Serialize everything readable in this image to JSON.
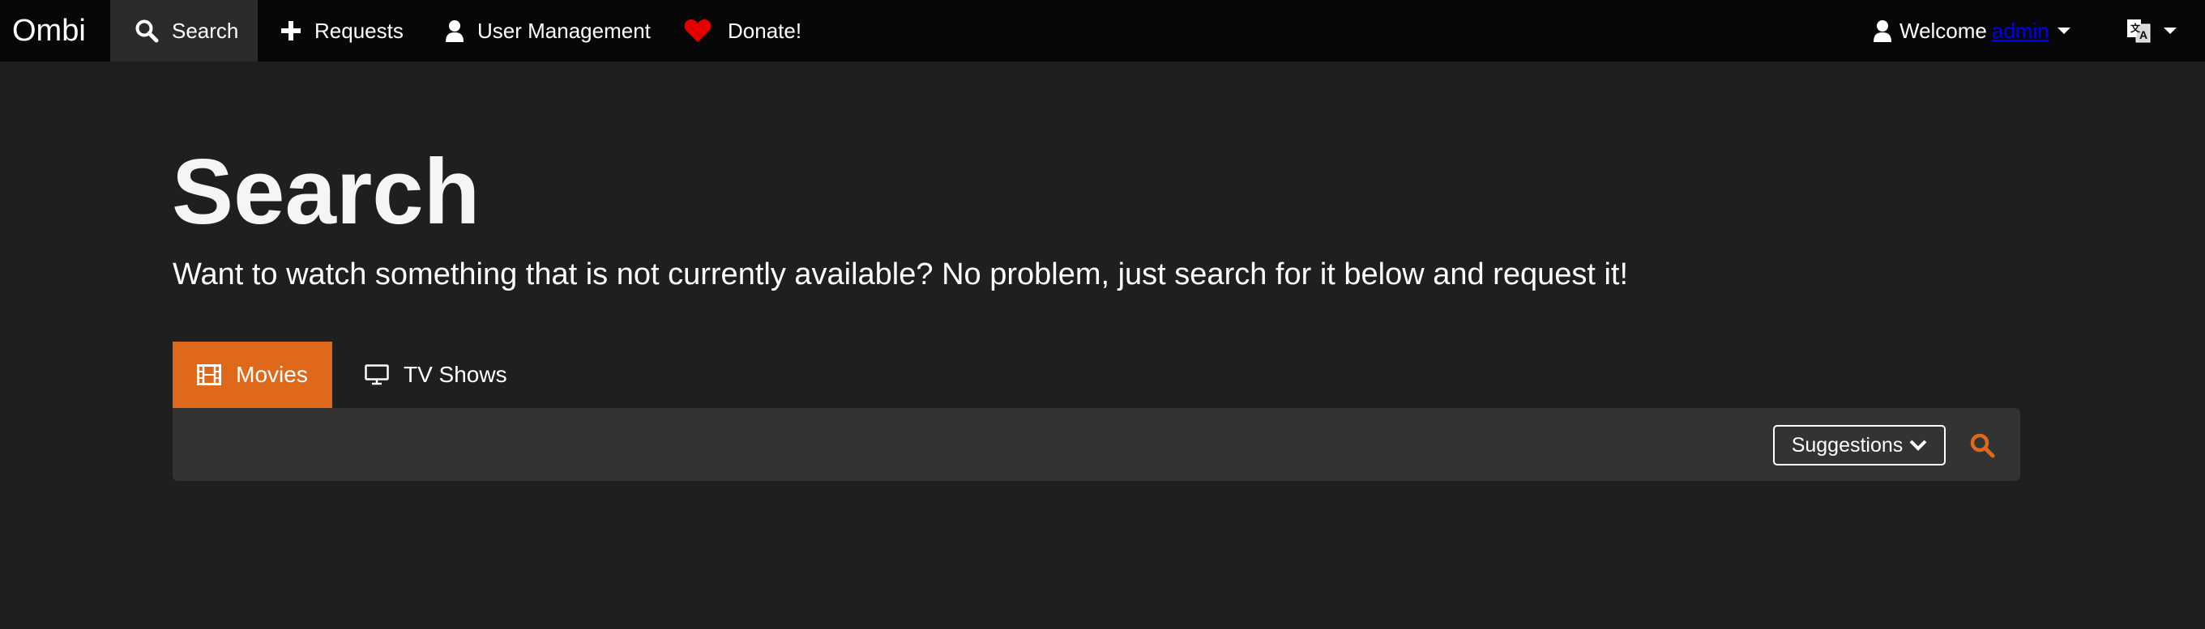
{
  "navbar": {
    "brand": "Ombi",
    "items": [
      {
        "label": "Search",
        "icon": "search-icon",
        "active": true
      },
      {
        "label": "Requests",
        "icon": "plus-icon"
      },
      {
        "label": "User Management",
        "icon": "user-icon"
      },
      {
        "label": "Donate!",
        "icon": "heart-icon"
      }
    ],
    "welcome_prefix": "Welcome",
    "welcome_name": "admin",
    "language_icon": "translate-icon"
  },
  "page": {
    "title": "Search",
    "subtitle": "Want to watch something that is not currently available? No problem, just search for it below and request it!"
  },
  "tabs": [
    {
      "label": "Movies",
      "icon": "film-icon",
      "active": true
    },
    {
      "label": "TV Shows",
      "icon": "monitor-icon"
    }
  ],
  "search": {
    "value": "",
    "placeholder": "",
    "suggestions_label": "Suggestions"
  },
  "colors": {
    "accent": "#df691a",
    "background": "#1f1f1f",
    "navbar": "#070707",
    "panel": "#333333",
    "heart": "#e50000"
  }
}
